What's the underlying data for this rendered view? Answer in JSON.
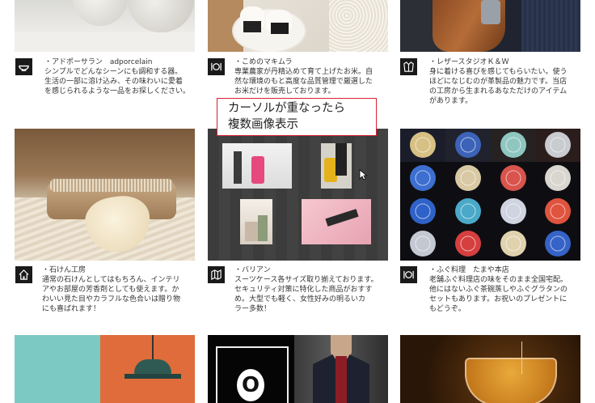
{
  "cards": [
    {
      "id": "adporcelain",
      "icon": "bowl-icon",
      "lines": [
        "・アドポーサラン　adporcelain",
        "シンプルでどんなシーンにも調和する器。",
        "生活の一部に溶け込み、その味わいに愛着",
        "を感じられるような一品をお探しください。"
      ]
    },
    {
      "id": "makimura",
      "icon": "dining-plate-icon",
      "lines": [
        "・こめのマキムラ",
        "専業農家が丹精込めて育て上げたお米。自",
        "然な環境のもと高度な品質管理で厳選した",
        "お米だけを販売しております。"
      ]
    },
    {
      "id": "leather",
      "icon": "jacket-icon",
      "lines": [
        "・レザースタジオＫ＆Ｗ",
        "身に着ける喜びを感じてもらいたい。使う",
        "ほどになじむのが革製品の魅力です。当店",
        "の工房から生まれるあなただけのアイテム",
        "があります。"
      ]
    },
    {
      "id": "soap",
      "icon": "house-icon",
      "lines": [
        "・石けん工房",
        "通常の石けんとしてはもちろん、インテリ",
        "アやお部屋の芳香剤としても使えます。か",
        "わいい見た目やカラフルな色合いは贈り物",
        "にも喜ばれます！"
      ]
    },
    {
      "id": "valiant",
      "icon": "map-icon",
      "lines": [
        "・バリアン",
        "スーツケース各サイズ取り揃えております。",
        "セキュリティ対策に特化した商品がおすす",
        "め。大型でも軽く、女性好みの明るいカ",
        "ラー多数！"
      ]
    },
    {
      "id": "fugu",
      "icon": "dining-plate-icon",
      "lines": [
        "・ふぐ料理　たまや本店",
        "老舗ふぐ料理店の味をそのまま全国宅配。",
        "他にはないふぐ茶碗蒸しやふぐグラタンの",
        "セットもあります。お祝いのプレゼントに",
        "もどうぞ。"
      ]
    }
  ],
  "callout": {
    "line1": "カーソルが重なったら",
    "line2": "複数画像表示"
  },
  "bottom_tile_letter": "O"
}
